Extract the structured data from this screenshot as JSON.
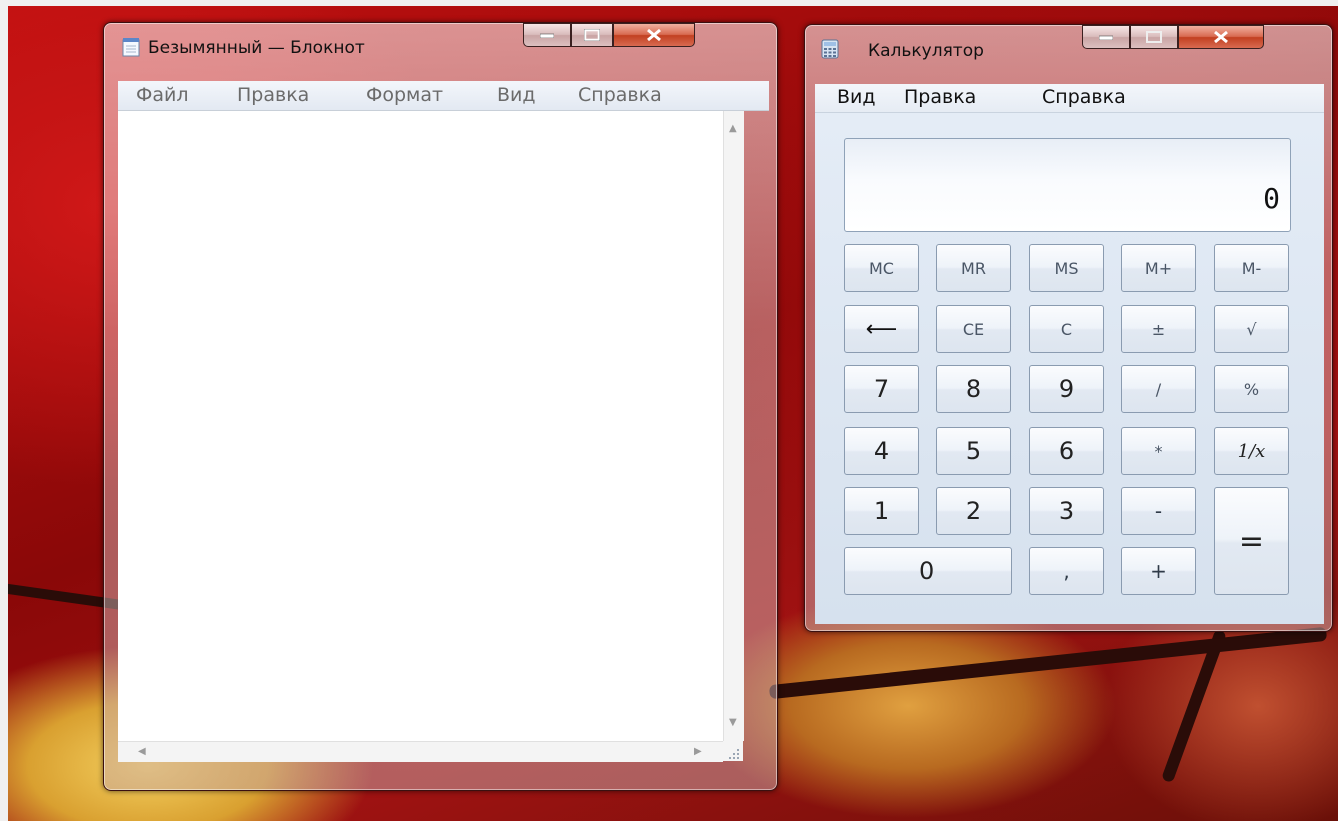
{
  "notepad": {
    "title": "Безымянный — Блокнот",
    "icon": "notepad-icon",
    "menu": [
      "Файл",
      "Правка",
      "Формат",
      "Вид",
      "Справка"
    ],
    "content": ""
  },
  "calculator": {
    "title": "Калькулятор",
    "icon": "calculator-icon",
    "menu": [
      "Вид",
      "Правка",
      "Справка"
    ],
    "display": "0",
    "keys": {
      "mc": "MC",
      "mr": "MR",
      "ms": "MS",
      "mplus": "M+",
      "mminus": "M-",
      "backspace": "⟵",
      "ce": "CE",
      "c": "C",
      "plusminus": "±",
      "sqrt": "√",
      "seven": "7",
      "eight": "8",
      "nine": "9",
      "divide": "/",
      "percent": "%",
      "four": "4",
      "five": "5",
      "six": "6",
      "multiply": "*",
      "reciprocal": "1/x",
      "one": "1",
      "two": "2",
      "three": "3",
      "minus": "-",
      "equals": "=",
      "zero": "0",
      "comma": ",",
      "plus": "+"
    }
  },
  "colors": {
    "desktop": "#b00e10",
    "close_button": "#c24020",
    "window_menu": "#e3e9f2"
  }
}
